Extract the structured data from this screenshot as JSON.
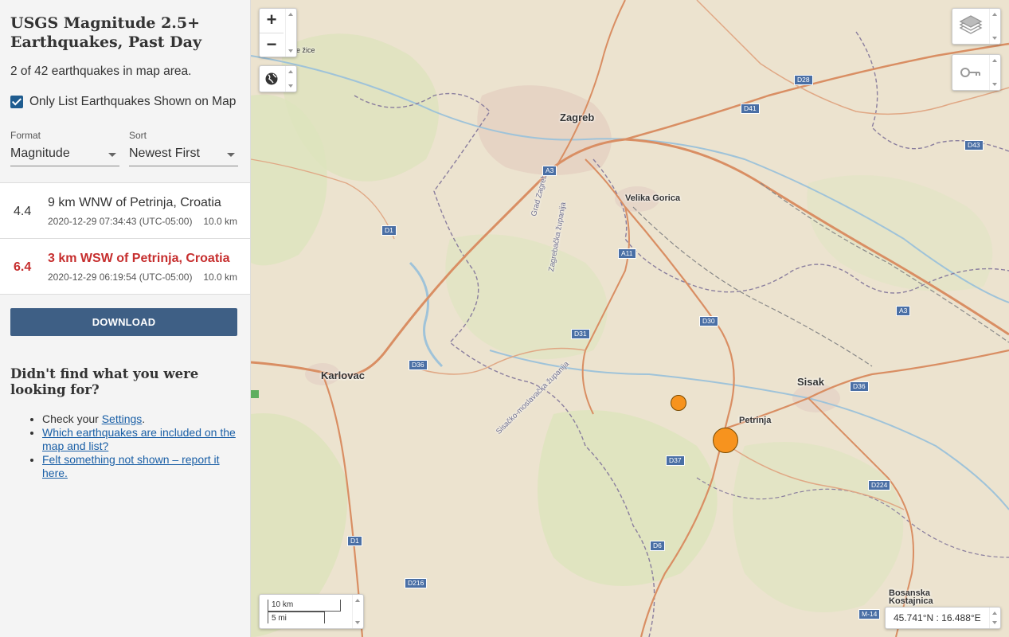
{
  "sidebar": {
    "title": "USGS Magnitude 2.5+ Earthquakes, Past Day",
    "count_text": "2 of 42 earthquakes in map area.",
    "only_list_label": "Only List Earthquakes Shown on Map",
    "format_label": "Format",
    "format_value": "Magnitude",
    "sort_label": "Sort",
    "sort_value": "Newest First",
    "events": [
      {
        "mag": "4.4",
        "place": "9 km WNW of Petrinja, Croatia",
        "time": "2020-12-29 07:34:43 (UTC-05:00)",
        "depth": "10.0 km"
      },
      {
        "mag": "6.4",
        "place": "3 km WSW of Petrinja, Croatia",
        "time": "2020-12-29 06:19:54 (UTC-05:00)",
        "depth": "10.0 km"
      }
    ],
    "download_label": "DOWNLOAD",
    "help_title": "Didn't find what you were looking for?",
    "help_check_prefix": "Check your ",
    "help_settings_link": "Settings",
    "help_check_suffix": ".",
    "help_link_included": "Which earthquakes are included on the map and list?",
    "help_link_report": "Felt something not shown – report it here."
  },
  "map": {
    "zoom_in": "+",
    "zoom_out": "−",
    "scale_km": "10 km",
    "scale_mi": "5 mi",
    "coords": "45.741°N : 16.488°E",
    "cities": {
      "zagreb": "Zagreb",
      "karlovac": "Karlovac",
      "sisak": "Sisak",
      "velika_gorica": "Velika Gorica",
      "petrinja": "Petrinja",
      "bosanska_kostajnica": "Bosanska Kostajnica",
      "zrezice": "re žice"
    },
    "roads": {
      "a3": "A3",
      "a3b": "A3",
      "a11": "A11",
      "d1": "D1",
      "d1b": "D1",
      "d28": "D28",
      "d41": "D41",
      "d43": "D43",
      "d30": "D30",
      "d31": "D31",
      "d36": "D36",
      "d36b": "D36",
      "d37": "D37",
      "d6": "D6",
      "d216": "D216",
      "d224": "D224",
      "m14": "M-14"
    },
    "county_labels": {
      "grad_zagreb": "Grad Zagreb",
      "zagrebacka": "Zagrebačka županija",
      "sisacko": "Sisačko-moslavačka županija"
    },
    "colors": {
      "quake": "#f7931e",
      "road": "#d9825b",
      "border": "#7a6f8a"
    }
  }
}
